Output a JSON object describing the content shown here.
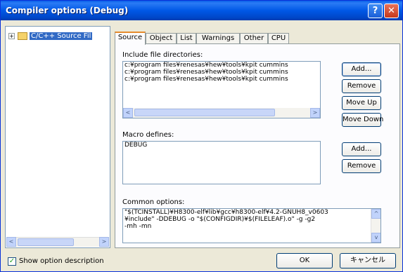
{
  "window": {
    "title": "Compiler options (Debug)",
    "help_label": "?",
    "close_label": "✕"
  },
  "tree": {
    "expander": "+",
    "items": [
      {
        "label": "C/C++ Source Fil"
      }
    ],
    "scroll_left": "<",
    "scroll_right": ">"
  },
  "tabs": [
    {
      "label": "Source"
    },
    {
      "label": "Object"
    },
    {
      "label": "List"
    },
    {
      "label": "Warnings"
    },
    {
      "label": "Other"
    },
    {
      "label": "CPU"
    }
  ],
  "include": {
    "label": "Include file directories:",
    "lines": [
      "c:¥program files¥renesas¥hew¥tools¥kpit cummins",
      "c:¥program files¥renesas¥hew¥tools¥kpit cummins",
      "c:¥program files¥renesas¥hew¥tools¥kpit cummins"
    ],
    "scroll_left": "<",
    "scroll_right": ">",
    "buttons": {
      "add": "Add...",
      "remove": "Remove",
      "move_up": "Move Up",
      "move_down": "Move Down"
    }
  },
  "macro": {
    "label": "Macro defines:",
    "lines": [
      "DEBUG"
    ],
    "buttons": {
      "add": "Add...",
      "remove": "Remove"
    }
  },
  "common": {
    "label": "Common options:",
    "lines": [
      "\"$(TCINSTALL)¥H8300-elf¥lib¥gcc¥h8300-elf¥4.2-GNUH8_v0603",
      "¥include\" -DDEBUG -o \"$(CONFIGDIR)¥$(FILELEAF).o\" -g -g2",
      "-mh -mn"
    ],
    "scroll_up": "^",
    "scroll_down": "v"
  },
  "footer": {
    "show_description_label": "Show option description",
    "checkbox_mark": "✓",
    "ok_label": "OK",
    "cancel_label": "キャンセル"
  },
  "colors": {
    "titlebar": "#0058E6",
    "selection": "#316AC5",
    "tab_highlight": "#E68B2C",
    "dialog_bg": "#ECE9D8"
  }
}
